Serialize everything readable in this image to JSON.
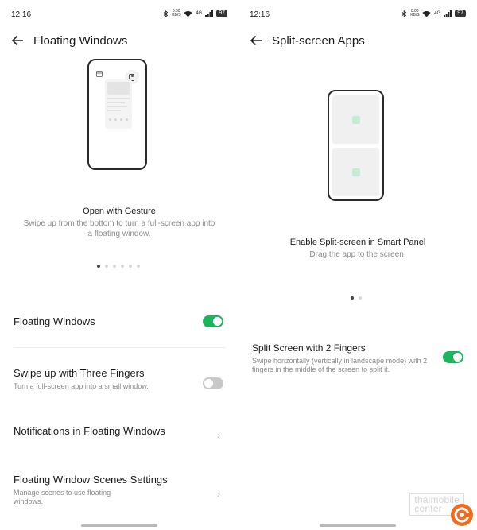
{
  "left_panel": {
    "status": {
      "time": "12:16",
      "speed": "0.00\nKB/S",
      "network": "4G",
      "battery": "97"
    },
    "header": {
      "title": "Floating Windows"
    },
    "illustration": {
      "title": "Open with Gesture",
      "description": "Swipe up from the bottom to turn a full-screen app into a floating window.",
      "page_count": 6,
      "active_page": 0
    },
    "settings": {
      "floating_windows": {
        "label": "Floating Windows",
        "enabled": true
      },
      "three_fingers": {
        "label": "Swipe up with Three Fingers",
        "description": "Turn a full-screen app into a small window.",
        "enabled": false
      },
      "notifications": {
        "label": "Notifications in Floating Windows"
      },
      "scenes": {
        "label": "Floating Window Scenes Settings",
        "description": "Manage scenes to use floating windows."
      }
    }
  },
  "right_panel": {
    "status": {
      "time": "12:16",
      "speed": "0.00\nKB/S",
      "network": "4G",
      "battery": "97"
    },
    "header": {
      "title": "Split-screen Apps"
    },
    "illustration": {
      "title": "Enable Split-screen in Smart Panel",
      "description": "Drag the app to the screen.",
      "page_count": 2,
      "active_page": 0
    },
    "settings": {
      "two_fingers": {
        "label": "Split Screen with 2 Fingers",
        "description": "Swipe horizontally (vertically in landscape mode) with 2 fingers in the middle of the screen to split it.",
        "enabled": true
      }
    }
  },
  "watermark": {
    "line1": "thaimobile",
    "line2": "center"
  },
  "colors": {
    "toggle_on": "#1bb55c",
    "toggle_off": "#c8c8c8",
    "accent_square": "#c5ecd2",
    "watermark_logo": "#f26a1b"
  }
}
